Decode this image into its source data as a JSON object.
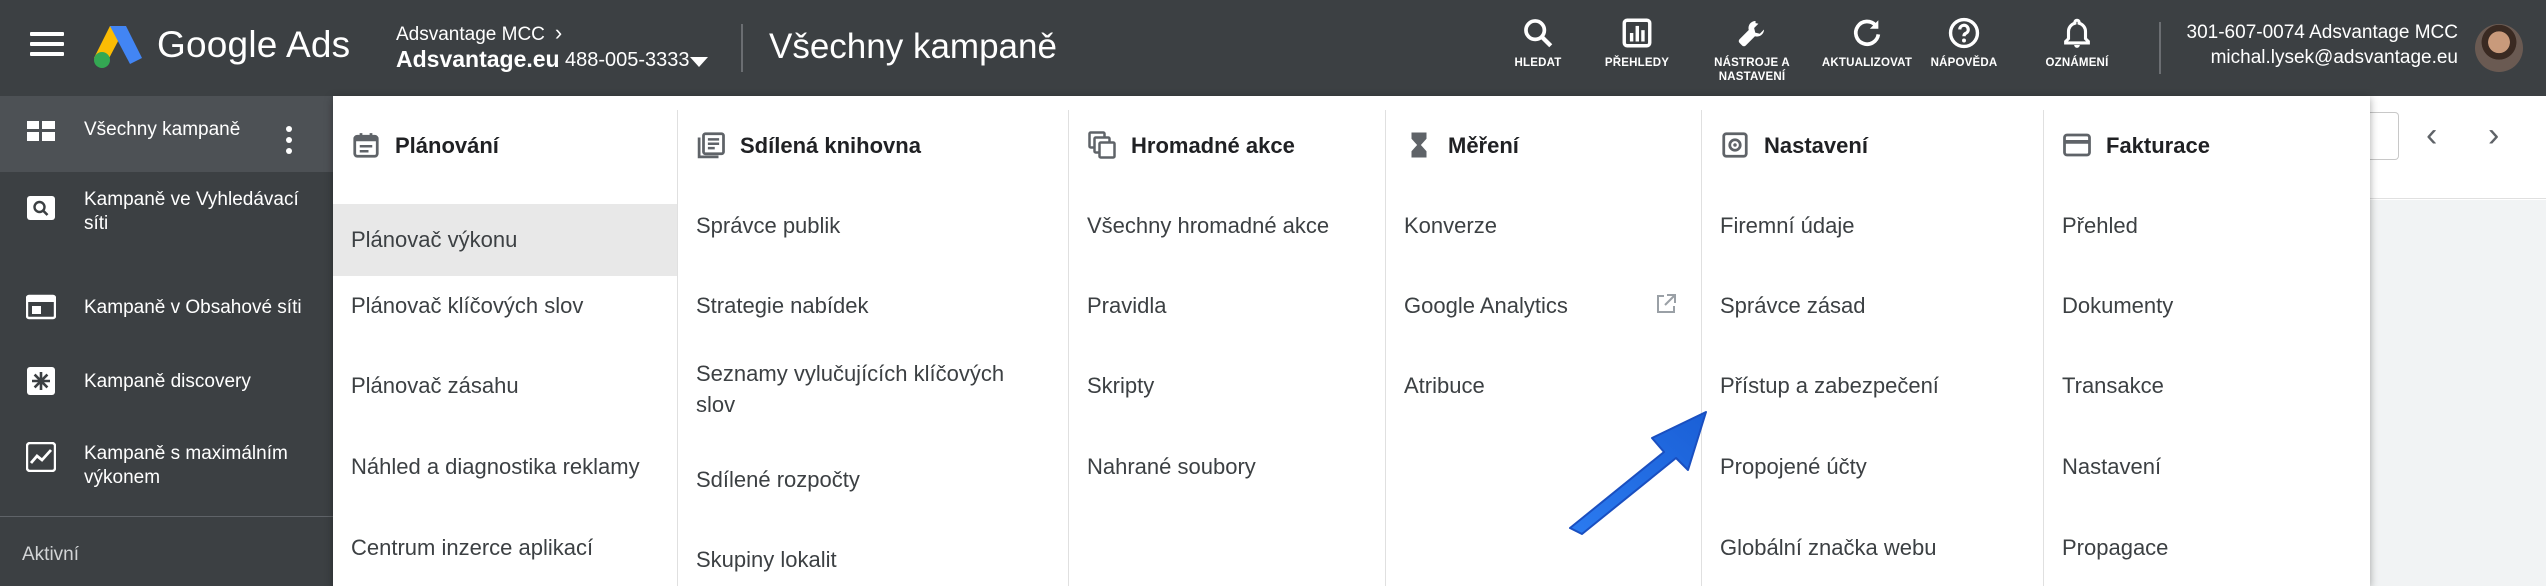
{
  "topbar": {
    "brand": "Google Ads",
    "account_top": "Adsvantage MCC",
    "account_name": "Adsvantage.eu",
    "account_id": "488-005-3333",
    "page_title": "Všechny kampaně",
    "tools": [
      {
        "icon": "search-icon",
        "label": "HLEDAT"
      },
      {
        "icon": "reports-icon",
        "label": "PŘEHLEDY"
      },
      {
        "icon": "wrench-icon",
        "label": "NÁSTROJE A NASTAVENÍ"
      },
      {
        "icon": "refresh-icon",
        "label": "AKTUALIZOVAT"
      },
      {
        "icon": "help-icon",
        "label": "NÁPOVĚDA"
      },
      {
        "icon": "bell-icon",
        "label": "OZNÁMENÍ"
      }
    ],
    "user_line1": "301-607-0074 Adsvantage MCC",
    "user_line2": "michal.lysek@adsvantage.eu"
  },
  "sidebar": {
    "items": [
      {
        "label": "Všechny kampaně",
        "icon": "dashboard-icon"
      },
      {
        "label": "Kampaně ve Vyhledávací síti",
        "icon": "search-campaign-icon"
      },
      {
        "label": "Kampaně v Obsahové síti",
        "icon": "display-icon"
      },
      {
        "label": "Kampaně discovery",
        "icon": "discovery-icon"
      },
      {
        "label": "Kampaně s maximálním výkonem",
        "icon": "performance-icon"
      }
    ],
    "section_label": "Aktivní"
  },
  "menu": {
    "columns": [
      {
        "heading": "Plánování",
        "icon": "calendar-icon",
        "items": [
          "Plánovač výkonu",
          "Plánovač klíčových slov",
          "Plánovač zásahu",
          "Náhled a diagnostika reklamy",
          "Centrum inzerce aplikací"
        ]
      },
      {
        "heading": "Sdílená knihovna",
        "icon": "library-icon",
        "items": [
          "Správce publik",
          "Strategie nabídek",
          "Seznamy vylučujících klíčových slov",
          "Sdílené rozpočty",
          "Skupiny lokalit"
        ]
      },
      {
        "heading": "Hromadné akce",
        "icon": "bulk-icon",
        "items": [
          "Všechny hromadné akce",
          "Pravidla",
          "Skripty",
          "Nahrané soubory"
        ]
      },
      {
        "heading": "Měření",
        "icon": "hourglass-icon",
        "items": [
          "Konverze",
          "Google Analytics",
          "Atribuce"
        ]
      },
      {
        "heading": "Nastavení",
        "icon": "settings-icon",
        "items": [
          "Firemní údaje",
          "Správce zásad",
          "Přístup a zabezpečení",
          "Propojené účty",
          "Globální značka webu"
        ]
      },
      {
        "heading": "Fakturace",
        "icon": "card-icon",
        "items": [
          "Přehled",
          "Dokumenty",
          "Transakce",
          "Nastavení",
          "Propagace"
        ]
      }
    ],
    "selected_item": "Plánovač výkonu"
  },
  "colors": {
    "topbar": "#3c4043",
    "selected_row": "#e8e8e8",
    "annotation_arrow": "#1a73e8"
  }
}
